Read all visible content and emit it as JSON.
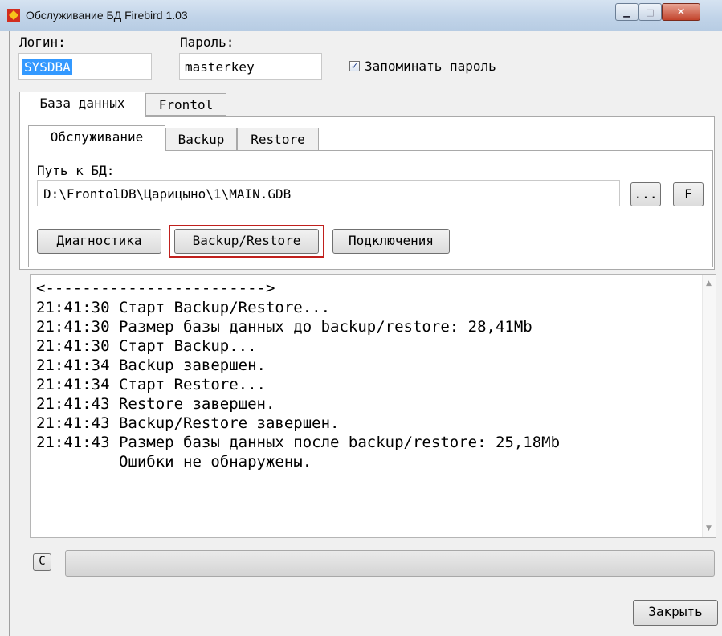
{
  "window": {
    "title": "Обслуживание БД Firebird 1.03",
    "controls": {
      "minimize": "▁",
      "maximize": "□",
      "close": "✕"
    }
  },
  "login": {
    "label": "Логин:",
    "value": "SYSDBA"
  },
  "password": {
    "label": "Пароль:",
    "value": "masterkey"
  },
  "remember": {
    "label": "Запоминать пароль",
    "checked": true,
    "mark": "✓"
  },
  "outer_tabs": [
    "База данных",
    "Frontol"
  ],
  "inner_tabs": [
    "Обслуживание",
    "Backup",
    "Restore"
  ],
  "db_path": {
    "label": "Путь к БД:",
    "value": "D:\\FrontolDB\\Царицыно\\1\\MAIN.GDB",
    "browse_button": "...",
    "f_button": "F"
  },
  "actions": {
    "diagnostics": "Диагностика",
    "backup_restore": "Backup/Restore",
    "connections": "Подключения"
  },
  "log_lines": [
    "<------------------------>",
    "21:41:30 Старт Backup/Restore...",
    "21:41:30 Размер базы данных до backup/restore: 28,41Mb",
    "21:41:30 Старт Backup...",
    "21:41:34 Backup завершен.",
    "21:41:34 Старт Restore...",
    "21:41:43 Restore завершен.",
    "21:41:43 Backup/Restore завершен.",
    "21:41:43 Размер базы данных после backup/restore: 25,18Mb",
    "         Ошибки не обнаружены."
  ],
  "scrollbar": {
    "up": "▲",
    "down": "▼"
  },
  "clear_button": "C",
  "progress": 0,
  "close_button": "Закрыть",
  "colors": {
    "selection": "#3399ff",
    "highlight_border": "#c0201d"
  }
}
